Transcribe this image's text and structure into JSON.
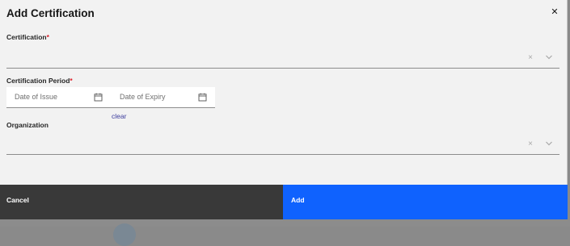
{
  "modal": {
    "title": "Add Certification",
    "close_icon": "close-icon"
  },
  "certification": {
    "label": "Certification",
    "required_mark": "*",
    "value": "",
    "clear_icon": "×"
  },
  "period": {
    "label": "Certification Period",
    "required_mark": "*",
    "issue_placeholder": "Date of Issue",
    "expiry_placeholder": "Date of Expiry",
    "calendar_icon": "calendar-icon",
    "clear_link": "clear"
  },
  "organization": {
    "label": "Organization",
    "value": "",
    "clear_icon": "×"
  },
  "footer": {
    "cancel_label": "Cancel",
    "add_label": "Add"
  },
  "colors": {
    "primary": "#0f62fe",
    "secondary": "#393939",
    "required": "#da1e28",
    "link": "#3d3d9e",
    "background": "#f2f2f2"
  }
}
